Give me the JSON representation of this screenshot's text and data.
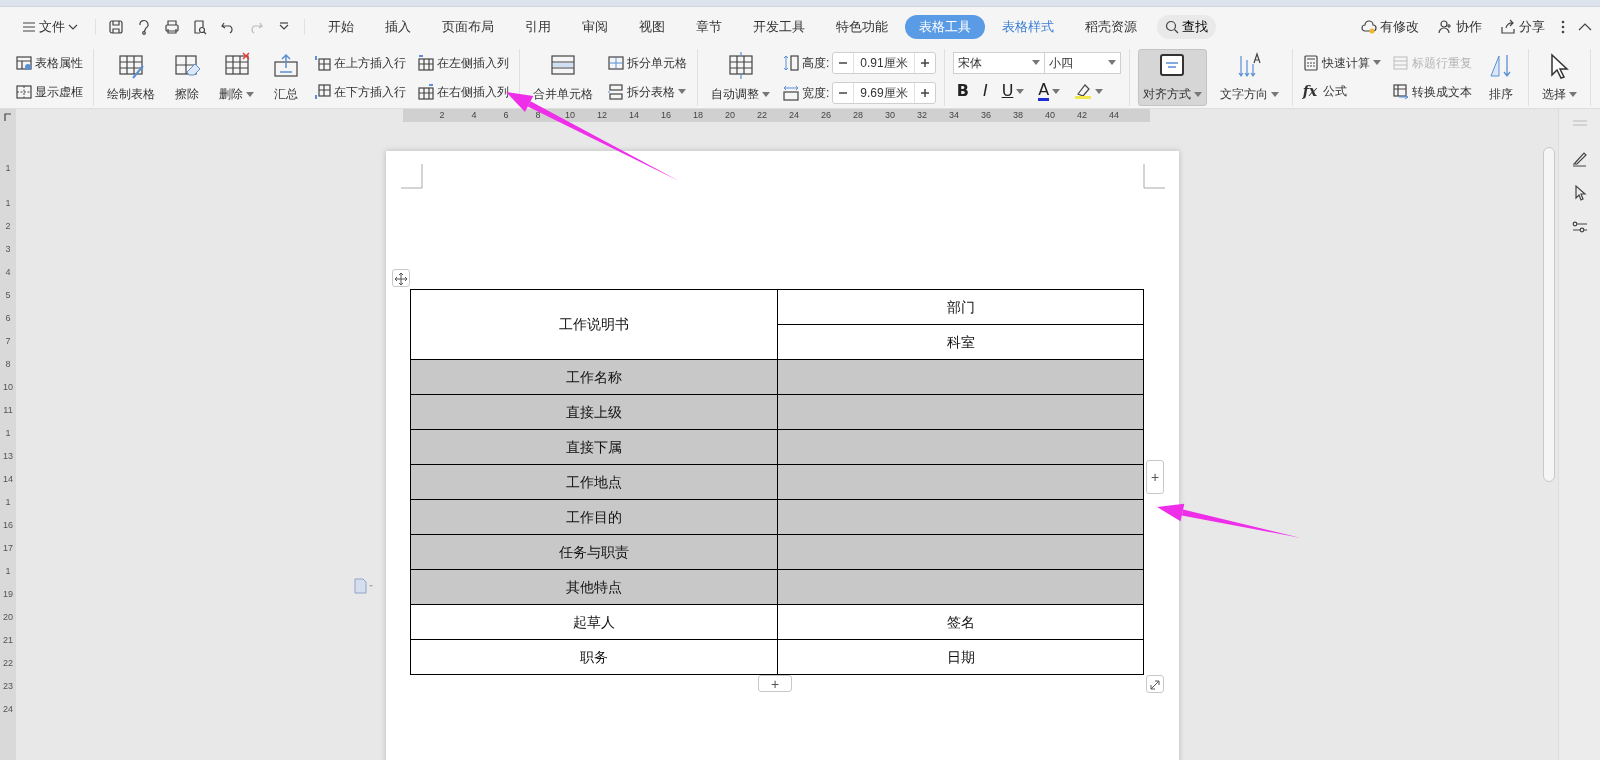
{
  "menu": {
    "file_label": "文件",
    "tabs": [
      {
        "label": "开始",
        "selected": false
      },
      {
        "label": "插入",
        "selected": false
      },
      {
        "label": "页面布局",
        "selected": false
      },
      {
        "label": "引用",
        "selected": false
      },
      {
        "label": "审阅",
        "selected": false
      },
      {
        "label": "视图",
        "selected": false
      },
      {
        "label": "章节",
        "selected": false
      },
      {
        "label": "开发工具",
        "selected": false
      },
      {
        "label": "特色功能",
        "selected": false
      },
      {
        "label": "表格工具",
        "selected": true
      },
      {
        "label": "表格样式",
        "selected": false
      },
      {
        "label": "稻壳资源",
        "selected": false
      }
    ],
    "search_label": "查找",
    "actions": [
      {
        "label": "有修改"
      },
      {
        "label": "协作"
      },
      {
        "label": "分享"
      }
    ]
  },
  "ribbon": [
    {
      "columns": [
        {
          "kind": "stack",
          "items": [
            {
              "label": "表格属性",
              "dropdown": false,
              "disabled": false
            },
            {
              "label": "显示虚框",
              "dropdown": false,
              "disabled": false
            }
          ]
        }
      ]
    },
    {
      "columns": [
        {
          "kind": "large",
          "label": "绘制表格",
          "dropdown": false,
          "pressed": false
        },
        {
          "kind": "large",
          "label": "擦除",
          "dropdown": false,
          "pressed": false
        },
        {
          "kind": "large",
          "label": "删除",
          "dropdown": true,
          "pressed": false
        },
        {
          "kind": "large",
          "label": "汇总",
          "dropdown": false,
          "pressed": false
        },
        {
          "kind": "stack",
          "items": [
            {
              "label": "在上方插入行",
              "dropdown": false,
              "disabled": false
            },
            {
              "label": "在下方插入行",
              "dropdown": false,
              "disabled": false
            }
          ]
        },
        {
          "kind": "stack",
          "items": [
            {
              "label": "在左侧插入列",
              "dropdown": false,
              "disabled": false
            },
            {
              "label": "在右侧插入列",
              "dropdown": false,
              "disabled": false
            }
          ]
        }
      ]
    },
    {
      "columns": [
        {
          "kind": "large",
          "label": "合并单元格",
          "dropdown": false,
          "pressed": false
        },
        {
          "kind": "stack",
          "items": [
            {
              "label": "拆分单元格",
              "dropdown": false,
              "disabled": false
            },
            {
              "label": "拆分表格",
              "dropdown": true,
              "disabled": false
            }
          ]
        }
      ]
    },
    {
      "columns": [
        {
          "kind": "large",
          "label": "自动调整",
          "dropdown": true,
          "pressed": false
        },
        {
          "kind": "spinners",
          "items": [
            {
              "label": "高度:",
              "value": "0.91厘米"
            },
            {
              "label": "宽度:",
              "value": "9.69厘米"
            }
          ]
        }
      ]
    },
    {
      "columns": [
        {
          "kind": "font",
          "font": "宋体",
          "size": "小四",
          "buttons": [
            {
              "glyph": "B",
              "dropdown": false
            },
            {
              "glyph": "I",
              "dropdown": false
            },
            {
              "glyph": "U",
              "dropdown": true
            },
            {
              "glyph": "A",
              "dropdown": true
            }
          ]
        }
      ]
    },
    {
      "columns": [
        {
          "kind": "large",
          "label": "对齐方式",
          "dropdown": true,
          "pressed": true
        },
        {
          "kind": "large",
          "label": "文字方向",
          "dropdown": true,
          "pressed": false
        }
      ]
    },
    {
      "columns": [
        {
          "kind": "stack",
          "items": [
            {
              "label": "快速计算",
              "dropdown": true,
              "disabled": false
            },
            {
              "label": "公式",
              "glyph": "fx",
              "dropdown": false,
              "disabled": false
            }
          ]
        },
        {
          "kind": "stack",
          "items": [
            {
              "label": "标题行重复",
              "dropdown": false,
              "disabled": true
            },
            {
              "label": "转换成文本",
              "dropdown": false,
              "disabled": false
            }
          ]
        },
        {
          "kind": "large",
          "label": "排序",
          "dropdown": false,
          "pressed": false
        }
      ]
    },
    {
      "columns": [
        {
          "kind": "large",
          "label": "选择",
          "dropdown": true,
          "pressed": false
        }
      ]
    }
  ],
  "ruler": {
    "horizontal_labels": [
      "2",
      "4",
      "6",
      "8",
      "10",
      "12",
      "14",
      "16",
      "18",
      "20",
      "22",
      "24",
      "26",
      "28",
      "30",
      "32",
      "34",
      "36",
      "38",
      "40",
      "42",
      "44"
    ],
    "vertical_labels": [
      "1",
      "1",
      "2",
      "3",
      "4",
      "5",
      "6",
      "7",
      "8",
      "10",
      "11",
      "1",
      "13",
      "14",
      "1",
      "16",
      "17",
      "1",
      "19",
      "20",
      "21",
      "22",
      "23",
      "24"
    ]
  },
  "document": {
    "table": {
      "rows": [
        {
          "shaded": false,
          "cells": [
            {
              "text": "工作说明书",
              "rowspan": 2
            },
            {
              "text": "部门"
            }
          ]
        },
        {
          "shaded": false,
          "cells": [
            {
              "text": "科室"
            }
          ]
        },
        {
          "shaded": true,
          "cells": [
            {
              "text": "工作名称"
            }
          ]
        },
        {
          "shaded": true,
          "cells": [
            {
              "text": "直接上级"
            }
          ]
        },
        {
          "shaded": true,
          "cells": [
            {
              "text": "直接下属"
            }
          ]
        },
        {
          "shaded": true,
          "cells": [
            {
              "text": "工作地点"
            }
          ]
        },
        {
          "shaded": true,
          "cells": [
            {
              "text": "工作目的"
            }
          ]
        },
        {
          "shaded": true,
          "cells": [
            {
              "text": "任务与职责"
            }
          ]
        },
        {
          "shaded": true,
          "cells": [
            {
              "text": "其他特点"
            }
          ]
        },
        {
          "shaded": false,
          "cells": [
            {
              "text": "起草人"
            },
            {
              "text": "签名"
            }
          ]
        },
        {
          "shaded": false,
          "cells": [
            {
              "text": "职务"
            },
            {
              "text": "日期"
            }
          ]
        }
      ]
    },
    "add_row_label": "+",
    "add_column_label": "+"
  }
}
